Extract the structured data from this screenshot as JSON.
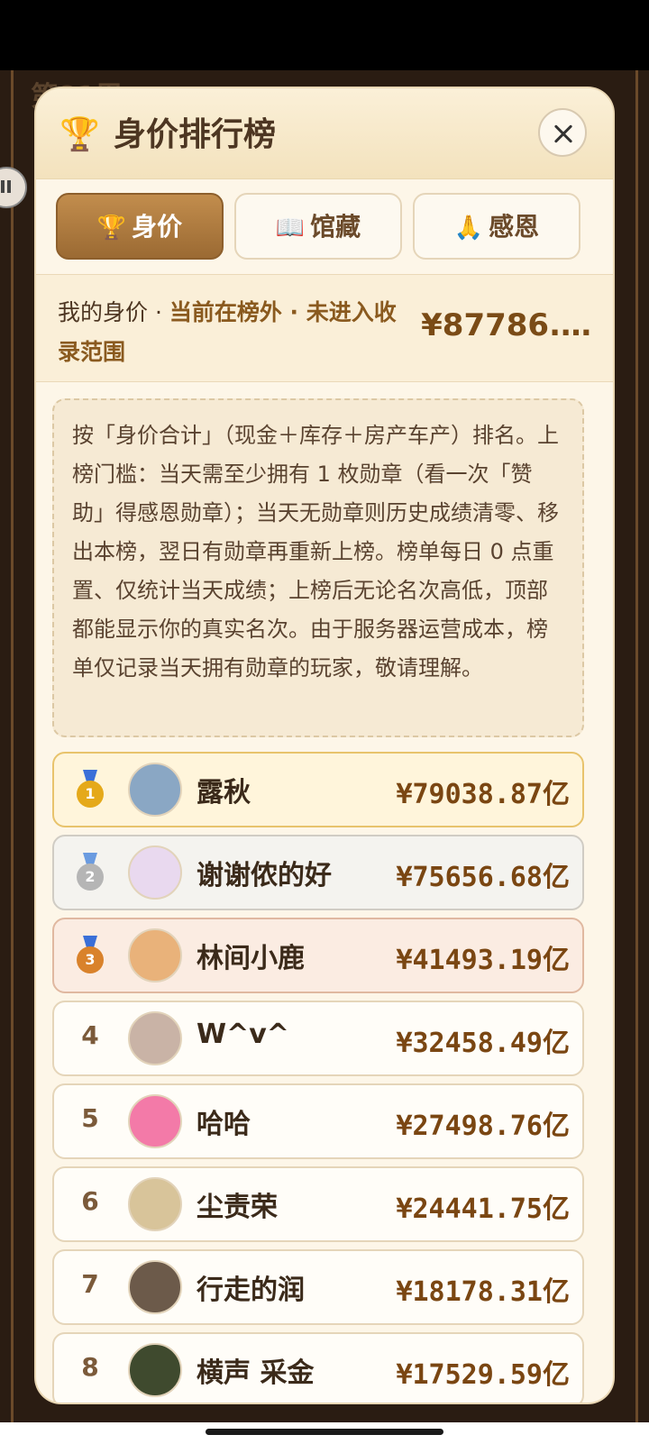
{
  "background": {
    "title": "第81周"
  },
  "header": {
    "icon": "trophy-icon",
    "title": "身价排行榜",
    "close_icon": "close-icon"
  },
  "tabs": [
    {
      "icon": "🏆",
      "label": "身价",
      "active": true
    },
    {
      "icon": "📖",
      "label": "馆藏",
      "active": false
    },
    {
      "icon": "🙏",
      "label": "感恩",
      "active": false
    }
  ],
  "status": {
    "prefix": "我的身价 · ",
    "highlight": "当前在榜外 · 未进入收录范围",
    "value": "¥87786.…"
  },
  "notice": "按「身价合计」（现金＋库存＋房产车产）排名。上榜门槛：当天需至少拥有 1 枚勋章（看一次「赞助」得感恩勋章）；当天无勋章则历史成绩清零、移出本榜，翌日有勋章再重新上榜。榜单每日 0 点重置、仅统计当天成绩；上榜后无论名次高低，顶部都能显示你的真实名次。由于服务器运营成本，榜单仅记录当天拥有勋章的玩家，敬请理解。",
  "ranking": [
    {
      "rank": "1",
      "name": "露秋",
      "amount": "¥79038.87亿",
      "tier": "gold",
      "avatar_color": "#8aa7c4"
    },
    {
      "rank": "2",
      "name": "谢谢侬的好",
      "amount": "¥75656.68亿",
      "tier": "silver",
      "avatar_color": "#e9d9ef"
    },
    {
      "rank": "3",
      "name": "林间小鹿",
      "amount": "¥41493.19亿",
      "tier": "bronze",
      "avatar_color": "#e9b27a"
    },
    {
      "rank": "4",
      "name": "W^v^",
      "amount": "¥32458.49亿",
      "tier": "",
      "avatar_color": "#c9b3a6"
    },
    {
      "rank": "5",
      "name": "哈哈",
      "amount": "¥27498.76亿",
      "tier": "",
      "avatar_color": "#f37aa8"
    },
    {
      "rank": "6",
      "name": "尘责荣",
      "amount": "¥24441.75亿",
      "tier": "",
      "avatar_color": "#d8c49a"
    },
    {
      "rank": "7",
      "name": "行走的润",
      "amount": "¥18178.31亿",
      "tier": "",
      "avatar_color": "#6c5a4a"
    },
    {
      "rank": "8",
      "name": "横声 采金",
      "amount": "¥17529.59亿",
      "tier": "",
      "avatar_color": "#3f4a2e"
    }
  ]
}
